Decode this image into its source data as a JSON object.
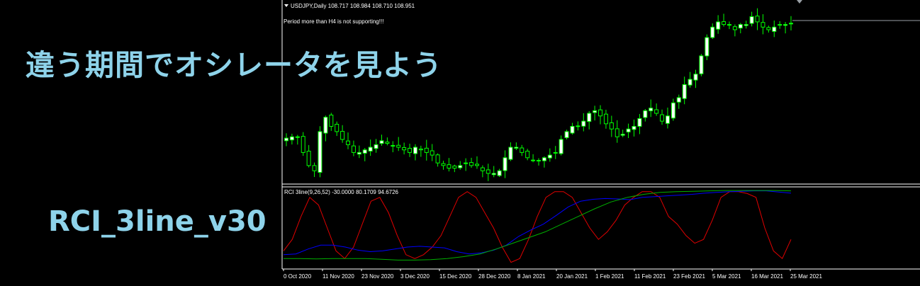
{
  "price_panel": {
    "symbol_info": "USDJPY,Daily  108.717 108.984 108.710 108.951",
    "notice": "Period more than H4 is not supporting!!!",
    "bull_color": "#00ff00",
    "bear_color": "#ffffff"
  },
  "indicator_panel": {
    "label": "RCI 3line(9,26,52) -30.0000 80.1709 94.6726",
    "line_colors": {
      "short": "#e00000",
      "mid": "#0000ff",
      "long": "#00b000"
    }
  },
  "overlay": {
    "headline": "違う期間でオシレータを見よう",
    "subheadline": "RCI_3line_v30"
  },
  "x_axis": {
    "labels": [
      "0 Oct 2020",
      "11 Nov 2020",
      "23 Nov 2020",
      "3 Dec 2020",
      "15 Dec 2020",
      "28 Dec 2020",
      "8 Jan 2021",
      "20 Jan 2021",
      "1 Feb 2021",
      "11 Feb 2021",
      "23 Feb 2021",
      "5 Mar 2021",
      "16 Mar 2021",
      "25 Mar 2021"
    ]
  },
  "chart_data": [
    {
      "type": "candlestick",
      "title": "USDJPY,Daily",
      "close_path": [
        104.55,
        104.6,
        104.6,
        104.0,
        103.5,
        103.3,
        104.8,
        105.35,
        105.0,
        104.8,
        104.5,
        104.3,
        104.0,
        104.0,
        104.1,
        104.2,
        104.3,
        104.45,
        104.35,
        104.25,
        104.2,
        104.1,
        104.0,
        104.2,
        104.1,
        104.0,
        103.9,
        103.6,
        103.5,
        103.4,
        103.4,
        103.5,
        103.6,
        103.5,
        103.5,
        103.3,
        103.2,
        103.2,
        103.3,
        103.8,
        104.2,
        104.2,
        104.0,
        103.8,
        103.7,
        103.7,
        103.8,
        103.9,
        104.0,
        104.5,
        104.8,
        105.0,
        105.0,
        105.2,
        105.5,
        105.6,
        105.4,
        105.1,
        104.9,
        104.6,
        104.7,
        104.9,
        105.0,
        105.3,
        105.6,
        105.7,
        105.5,
        105.2,
        105.4,
        105.9,
        106.1,
        106.6,
        106.8,
        107.0,
        107.7,
        108.4,
        108.8,
        109.0,
        108.9,
        108.9,
        108.7,
        108.9,
        108.9,
        109.2,
        109.0,
        108.8,
        108.7,
        108.8,
        108.9,
        108.9,
        108.95
      ]
    },
    {
      "type": "line",
      "title": "RCI 3line(9,26,52)",
      "series": [
        {
          "name": "short",
          "values": [
            -60,
            -30,
            30,
            80,
            60,
            0,
            -60,
            -80,
            -50,
            10,
            70,
            80,
            40,
            -20,
            -70,
            -80,
            -70,
            -50,
            -20,
            30,
            80,
            95,
            80,
            40,
            0,
            -50,
            -90,
            -80,
            -30,
            30,
            80,
            95,
            95,
            80,
            40,
            0,
            -30,
            -10,
            20,
            60,
            80,
            95,
            95,
            80,
            30,
            10,
            -20,
            -40,
            -30,
            20,
            80,
            95,
            95,
            90,
            80,
            0,
            -60,
            -80,
            -30
          ]
        },
        {
          "name": "mid",
          "values": [
            -70,
            -68,
            -55,
            -45,
            -45,
            -50,
            -58,
            -62,
            -60,
            -55,
            -50,
            -48,
            -50,
            -52,
            -62,
            -68,
            -65,
            -58,
            -45,
            -22,
            -5,
            10,
            32,
            55,
            70,
            75,
            77,
            76,
            74,
            80,
            82,
            84,
            86,
            88,
            91,
            93,
            95,
            96,
            97,
            97,
            94,
            91
          ]
        },
        {
          "name": "long",
          "values": [
            -80,
            -80,
            -81,
            -80,
            -80,
            -80,
            -82,
            -84,
            -84,
            -83,
            -80,
            -75,
            -68,
            -55,
            -40,
            -25,
            -10,
            10,
            30,
            50,
            68,
            80,
            88,
            93,
            95,
            96,
            97,
            98,
            98,
            98,
            98,
            97
          ]
        }
      ],
      "ylim": [
        -100,
        100
      ]
    }
  ]
}
